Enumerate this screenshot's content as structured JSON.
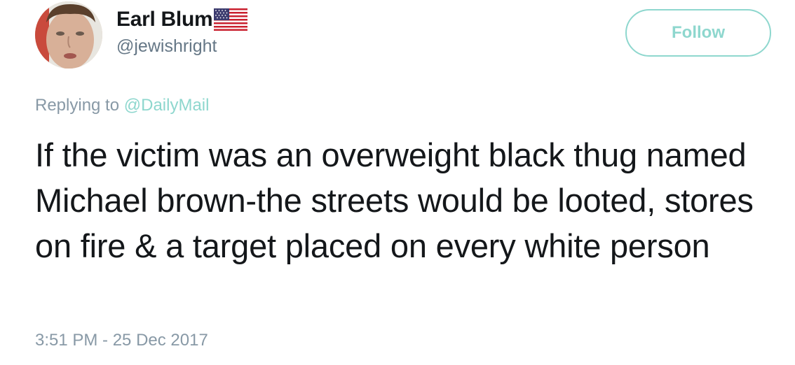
{
  "author": {
    "display_name": "Earl Blum",
    "handle": "@jewishright",
    "flag_icon": "us-flag-icon"
  },
  "follow_button": {
    "label": "Follow",
    "color": "#8ed7ce"
  },
  "reply": {
    "prefix": "Replying to ",
    "mention": "@DailyMail"
  },
  "tweet": {
    "text": "If the victim was an overweight black thug named Michael brown-the streets would be looted, stores on fire & a target placed on every white person",
    "timestamp": "3:51 PM - 25 Dec 2017"
  },
  "colors": {
    "text": "#14171a",
    "secondary": "#8899a6",
    "accent": "#8ed7ce"
  }
}
